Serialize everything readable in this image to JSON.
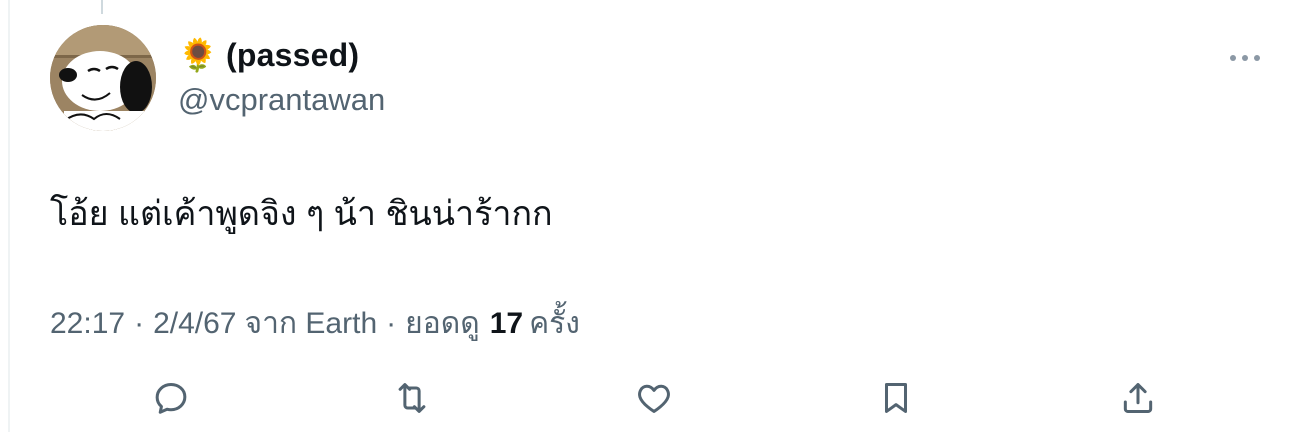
{
  "tweet": {
    "author": {
      "emoji": "🌻",
      "display_name": "(passed)",
      "handle": "@vcprantawan"
    },
    "text": "โอ้ย แต่เค้าพูดจิง ๆ น้า ชินน่าร้ากก",
    "meta": {
      "time": "22:17",
      "separator": "·",
      "date": "2/4/67",
      "source": "จาก Earth",
      "views_label": "ยอดดู",
      "views_count": "17",
      "views_suffix": "ครั้ง"
    },
    "actions": [
      "reply-icon",
      "retweet-icon",
      "like-icon",
      "bookmark-icon",
      "share-icon"
    ]
  },
  "colors": {
    "text_primary": "#0f1419",
    "text_secondary": "#536471",
    "icon": "#536471",
    "divider": "#eff3f4"
  }
}
